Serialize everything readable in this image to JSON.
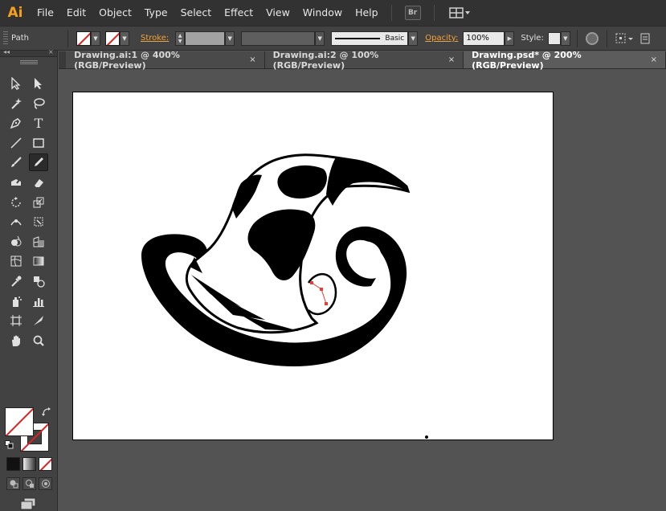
{
  "app": {
    "logo": "Ai",
    "accent": "#f7a01c"
  },
  "menu": [
    "File",
    "Edit",
    "Object",
    "Type",
    "Select",
    "Effect",
    "View",
    "Window",
    "Help"
  ],
  "menubar_extras": {
    "bridge_label": "Br"
  },
  "control": {
    "selection_label": "Path",
    "stroke_label": "Stroke:",
    "brush_label": "Basic",
    "opacity_label": "Opacity:",
    "opacity_value": "100%",
    "style_label": "Style:"
  },
  "tabs": [
    {
      "label": "Drawing.ai:1 @ 400% (RGB/Preview)",
      "active": false
    },
    {
      "label": "Drawing.ai:2 @ 100% (RGB/Preview)",
      "active": false
    },
    {
      "label": "Drawing.psd* @ 200% (RGB/Preview)",
      "active": true
    }
  ],
  "tab_close": "×",
  "toolpanel": {
    "collapse": "◂◂",
    "close": "×"
  },
  "tools": [
    "selection-tool",
    "direct-selection-tool",
    "magic-wand-tool",
    "lasso-tool",
    "pen-tool",
    "type-tool",
    "line-segment-tool",
    "rectangle-tool",
    "paintbrush-tool",
    "pencil-tool",
    "blob-brush-tool",
    "eraser-tool",
    "rotate-tool",
    "scale-tool",
    "width-tool",
    "free-transform-tool",
    "shape-builder-tool",
    "perspective-grid-tool",
    "mesh-tool",
    "gradient-tool",
    "eyedropper-tool",
    "blend-tool",
    "symbol-sprayer-tool",
    "column-graph-tool",
    "artboard-tool",
    "slice-tool",
    "hand-tool",
    "zoom-tool"
  ],
  "active_tool": "pencil-tool",
  "colors": {
    "none_slash": "#e02020",
    "panel": "#424242",
    "canvas": "#535353",
    "menubar": "#323232"
  }
}
